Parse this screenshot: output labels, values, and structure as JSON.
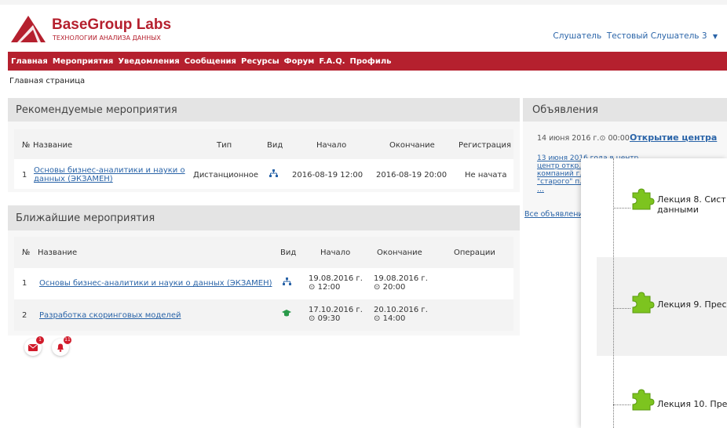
{
  "brand": {
    "title": "BaseGroup Labs",
    "subtitle": "ТЕХНОЛОГИИ АНАЛИЗА ДАННЫХ",
    "color": "#b5202e"
  },
  "user": {
    "role": "Слушатель",
    "name": "Тестовый Слушатель 3"
  },
  "nav": [
    "Главная",
    "Мероприятия",
    "Уведомления",
    "Сообщения",
    "Ресурсы",
    "Форум",
    "F.A.Q.",
    "Профиль"
  ],
  "breadcrumb": "Главная страница",
  "recommended": {
    "title": "Рекомендуемые мероприятия",
    "headers": {
      "num": "№",
      "name": "Название",
      "type": "Тип",
      "view": "Вид",
      "start": "Начало",
      "end": "Окончание",
      "reg": "Регистрация"
    },
    "rows": [
      {
        "num": "1",
        "name_line1": "Основы бизнес-аналитики и науки о",
        "name_line2": "данных (ЭКЗАМЕН)",
        "type": "Дистанционное",
        "view_icon": "hierarchy-icon",
        "start": "2016-08-19 12:00",
        "end": "2016-08-19 20:00",
        "reg": "Не начата"
      }
    ]
  },
  "nearest": {
    "title": "Ближайшие мероприятия",
    "headers": {
      "num": "№",
      "name": "Название",
      "view": "Вид",
      "start": "Начало",
      "end": "Окончание",
      "ops": "Операции"
    },
    "rows": [
      {
        "num": "1",
        "name": "Основы бизнес-аналитики и науки о данных (ЭКЗАМЕН)",
        "view_icon": "hierarchy-icon",
        "start_date": "19.08.2016 г.",
        "start_time": "12:00",
        "end_date": "19.08.2016 г.",
        "end_time": "20:00"
      },
      {
        "num": "2",
        "name": "Разработка скоринговых моделей",
        "view_icon": "graduation-cap-icon",
        "start_date": "17.10.2016 г.",
        "start_time": "09:30",
        "end_date": "20.10.2016 г.",
        "end_time": "14:00"
      }
    ]
  },
  "badges": {
    "messages": "1",
    "notifications": "11"
  },
  "announcements": {
    "title": "Объявления",
    "item_date": "14 июня 2016 г.",
    "item_time": "00:00",
    "item_title": "Открытие центра",
    "snippet": [
      "13 июня 2016 года в центр…",
      "центр откр…",
      "компаний г…",
      "\"старого\" п…",
      "…"
    ],
    "all_link": "Все объявлени…"
  },
  "lectures": [
    "Лекция 8. Сист…",
    "данными",
    "Лекция 9. Прес…",
    "Лекция 10. Пре…"
  ],
  "colors": {
    "accent": "#b5202e",
    "link": "#2a64a8",
    "puzzle": "#7dc41f",
    "badge": "#d11a2a"
  }
}
